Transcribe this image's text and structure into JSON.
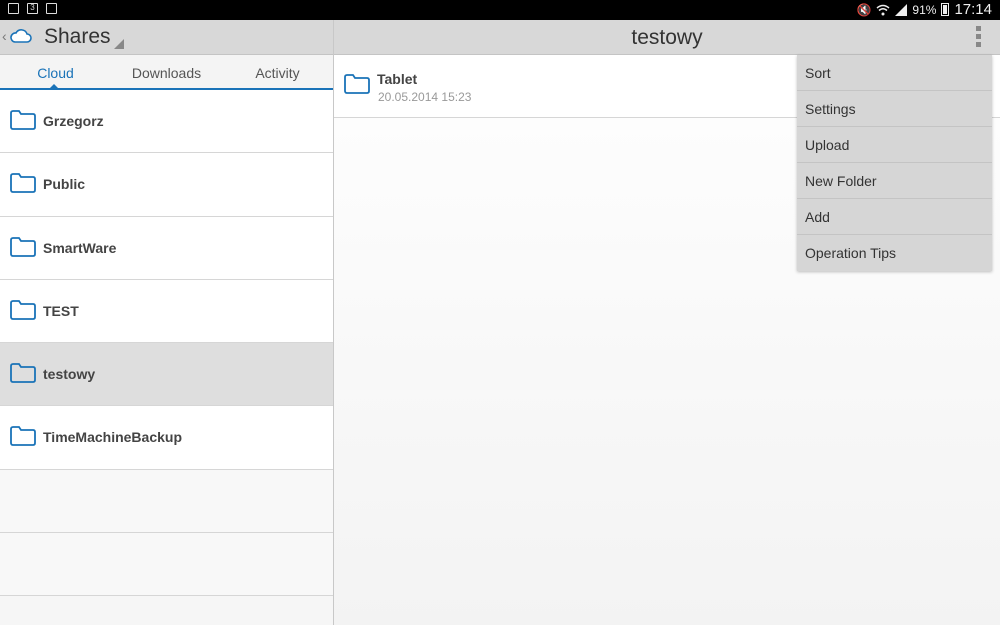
{
  "status_bar": {
    "battery_percent": "91%",
    "time": "17:14",
    "left_icons": [
      "image-notification-icon",
      "calendar-icon",
      "clipboard-icon"
    ],
    "right_icons": [
      "mute-icon",
      "wifi-icon",
      "signal-icon",
      "battery-icon"
    ]
  },
  "left_panel": {
    "title": "Shares",
    "tabs": [
      {
        "label": "Cloud",
        "active": true
      },
      {
        "label": "Downloads",
        "active": false
      },
      {
        "label": "Activity",
        "active": false
      }
    ],
    "folders": [
      {
        "name": "Grzegorz",
        "selected": false
      },
      {
        "name": "Public",
        "selected": false
      },
      {
        "name": "SmartWare",
        "selected": false
      },
      {
        "name": "TEST",
        "selected": false
      },
      {
        "name": "testowy",
        "selected": true
      },
      {
        "name": "TimeMachineBackup",
        "selected": false
      }
    ]
  },
  "right_panel": {
    "title": "testowy",
    "items": [
      {
        "name": "Tablet",
        "date": "20.05.2014 15:23"
      }
    ]
  },
  "menu": {
    "items": [
      "Sort",
      "Settings",
      "Upload",
      "New Folder",
      "Add",
      "Operation Tips"
    ]
  },
  "colors": {
    "accent": "#1a73b8",
    "header_bg": "#d8d8d8",
    "selected_row": "#dedede"
  }
}
